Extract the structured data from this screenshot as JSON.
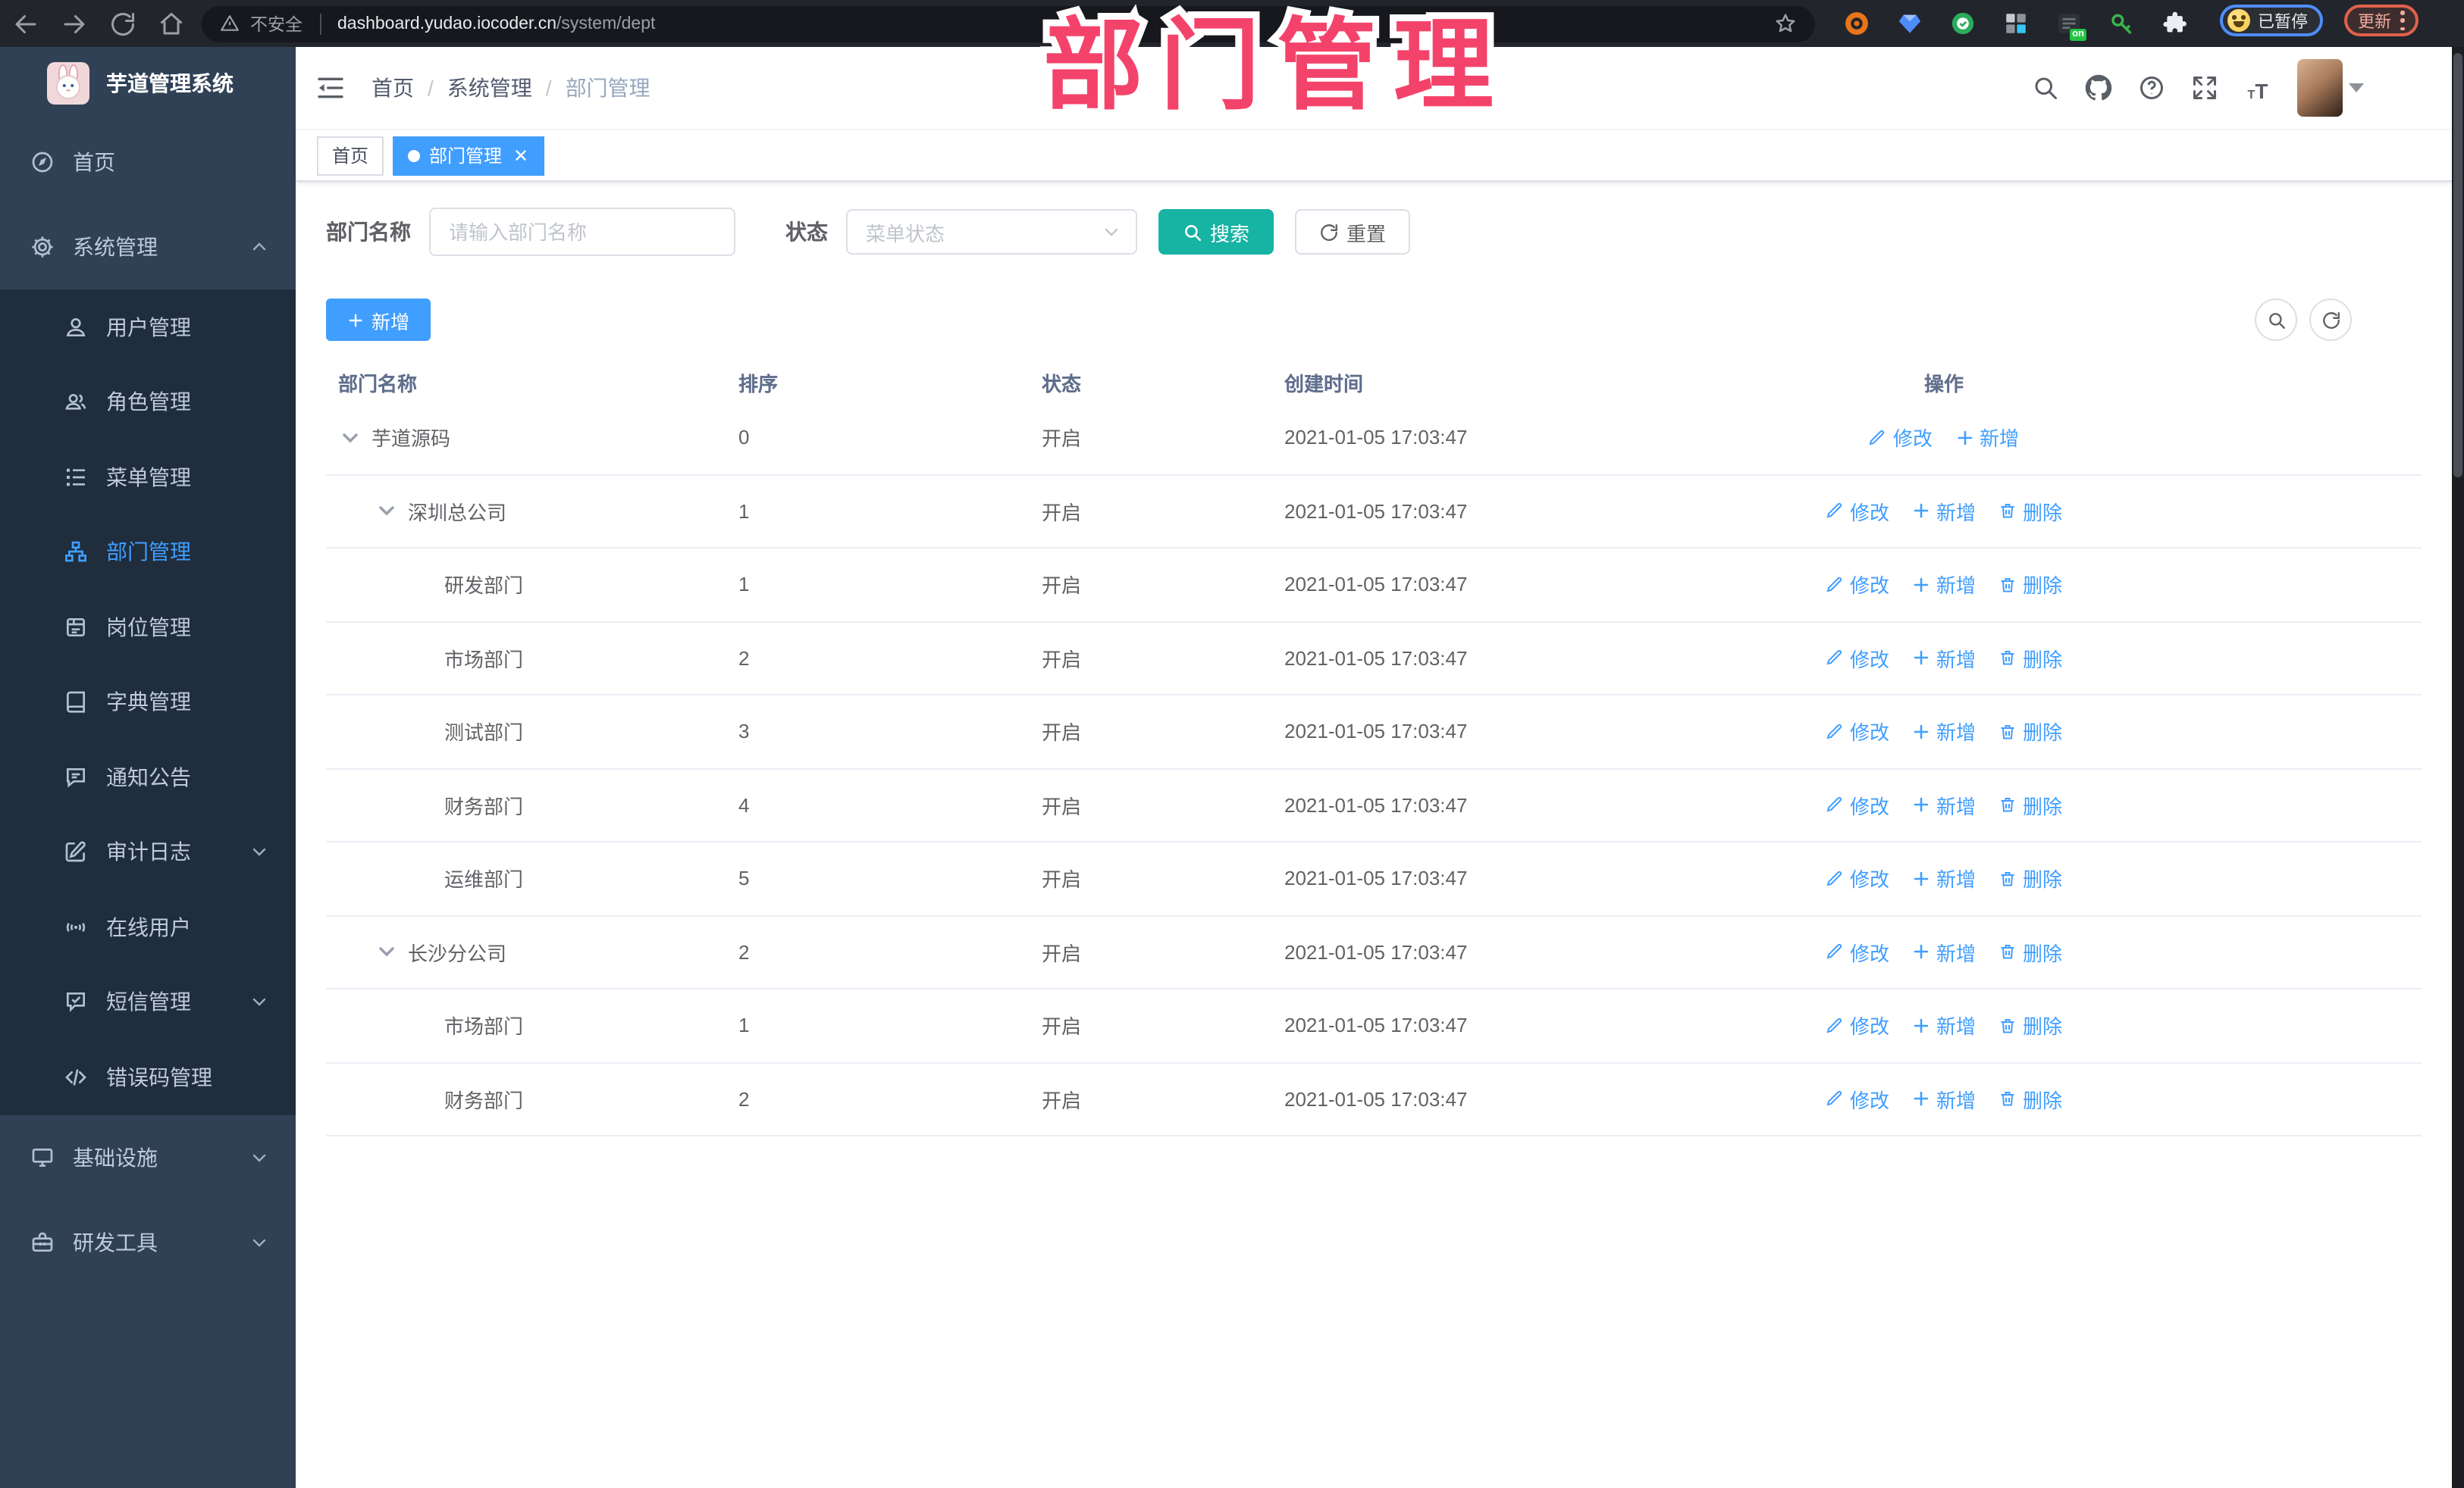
{
  "watermark": "部门管理",
  "browser": {
    "security_label": "不安全",
    "url_host": "dashboard.yudao.iocoder.cn",
    "url_path": "/system/dept",
    "on_badge": "on",
    "profile_status": "已暂停",
    "update_label": "更新"
  },
  "app": {
    "title": "芋道管理系统"
  },
  "breadcrumb": {
    "items": [
      "首页",
      "系统管理",
      "部门管理"
    ],
    "separator": "/"
  },
  "tabs": [
    {
      "label": "首页",
      "active": false
    },
    {
      "label": "部门管理",
      "active": true
    }
  ],
  "sidebar": {
    "items": [
      {
        "label": "首页",
        "icon": "dashboard-icon"
      },
      {
        "label": "系统管理",
        "icon": "gear-icon",
        "chevron": "up",
        "open": true,
        "children": [
          {
            "label": "用户管理",
            "icon": "user-icon"
          },
          {
            "label": "角色管理",
            "icon": "users-icon"
          },
          {
            "label": "菜单管理",
            "icon": "menu-tree-icon"
          },
          {
            "label": "部门管理",
            "icon": "org-tree-icon",
            "active": true
          },
          {
            "label": "岗位管理",
            "icon": "badge-icon"
          },
          {
            "label": "字典管理",
            "icon": "book-icon"
          },
          {
            "label": "通知公告",
            "icon": "notice-icon"
          },
          {
            "label": "审计日志",
            "icon": "audit-icon",
            "chevron": "down"
          },
          {
            "label": "在线用户",
            "icon": "online-icon"
          },
          {
            "label": "短信管理",
            "icon": "sms-icon",
            "chevron": "down"
          },
          {
            "label": "错误码管理",
            "icon": "code-icon"
          }
        ]
      },
      {
        "label": "基础设施",
        "icon": "monitor-icon",
        "chevron": "down"
      },
      {
        "label": "研发工具",
        "icon": "toolbox-icon",
        "chevron": "down"
      }
    ]
  },
  "filter": {
    "name_label": "部门名称",
    "name_placeholder": "请输入部门名称",
    "status_label": "状态",
    "status_placeholder": "菜单状态",
    "search_label": "搜索",
    "reset_label": "重置"
  },
  "toolbar": {
    "add_label": "新增"
  },
  "table": {
    "headers": [
      "部门名称",
      "排序",
      "状态",
      "创建时间",
      "操作"
    ],
    "action_labels": {
      "modify": "修改",
      "add": "新增",
      "delete": "删除"
    },
    "rows": [
      {
        "name": "芋道源码",
        "level": 0,
        "expandable": true,
        "sort": "0",
        "status": "开启",
        "create_time": "2021-01-05 17:03:47",
        "actions": [
          "modify",
          "add"
        ]
      },
      {
        "name": "深圳总公司",
        "level": 1,
        "expandable": true,
        "sort": "1",
        "status": "开启",
        "create_time": "2021-01-05 17:03:47",
        "actions": [
          "modify",
          "add",
          "delete"
        ]
      },
      {
        "name": "研发部门",
        "level": 2,
        "expandable": false,
        "sort": "1",
        "status": "开启",
        "create_time": "2021-01-05 17:03:47",
        "actions": [
          "modify",
          "add",
          "delete"
        ]
      },
      {
        "name": "市场部门",
        "level": 2,
        "expandable": false,
        "sort": "2",
        "status": "开启",
        "create_time": "2021-01-05 17:03:47",
        "actions": [
          "modify",
          "add",
          "delete"
        ]
      },
      {
        "name": "测试部门",
        "level": 2,
        "expandable": false,
        "sort": "3",
        "status": "开启",
        "create_time": "2021-01-05 17:03:47",
        "actions": [
          "modify",
          "add",
          "delete"
        ]
      },
      {
        "name": "财务部门",
        "level": 2,
        "expandable": false,
        "sort": "4",
        "status": "开启",
        "create_time": "2021-01-05 17:03:47",
        "actions": [
          "modify",
          "add",
          "delete"
        ]
      },
      {
        "name": "运维部门",
        "level": 2,
        "expandable": false,
        "sort": "5",
        "status": "开启",
        "create_time": "2021-01-05 17:03:47",
        "actions": [
          "modify",
          "add",
          "delete"
        ]
      },
      {
        "name": "长沙分公司",
        "level": 1,
        "expandable": true,
        "sort": "2",
        "status": "开启",
        "create_time": "2021-01-05 17:03:47",
        "actions": [
          "modify",
          "add",
          "delete"
        ]
      },
      {
        "name": "市场部门",
        "level": 2,
        "expandable": false,
        "sort": "1",
        "status": "开启",
        "create_time": "2021-01-05 17:03:47",
        "actions": [
          "modify",
          "add",
          "delete"
        ]
      },
      {
        "name": "财务部门",
        "level": 2,
        "expandable": false,
        "sort": "2",
        "status": "开启",
        "create_time": "2021-01-05 17:03:47",
        "actions": [
          "modify",
          "add",
          "delete"
        ]
      }
    ]
  },
  "colors": {
    "accent": "#409eff",
    "search_button": "#17b3a3",
    "sidebar_bg": "#304156",
    "submenu_bg": "#1f2d3d",
    "watermark": "#f4436b"
  }
}
